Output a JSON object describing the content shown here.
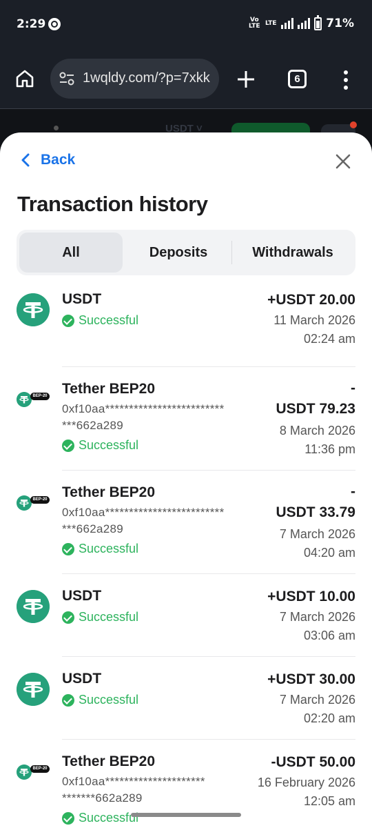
{
  "status_bar": {
    "time": "2:29",
    "volte": "Vo\nLTE",
    "lte": "LTE",
    "battery": "71%"
  },
  "browser": {
    "url": "1wqldy.com/?p=7xkk",
    "tab_count": "6"
  },
  "background": {
    "currency": "USDT ˅"
  },
  "header": {
    "back_label": "Back",
    "title": "Transaction history"
  },
  "tabs": [
    {
      "label": "All",
      "active": true
    },
    {
      "label": "Deposits",
      "active": false
    },
    {
      "label": "Withdrawals",
      "active": false
    }
  ],
  "transactions": [
    {
      "name": "USDT",
      "status": "Successful",
      "amount": "+USDT 20.00",
      "date": "11 March 2026",
      "time": "02:24 am"
    },
    {
      "name": "Tether BEP20",
      "address": "0xf10aa*************************\n***662a289",
      "badge": "BEP-20",
      "status": "Successful",
      "amount": "-\nUSDT 79.23",
      "date": "8 March 2026",
      "time": "11:36 pm"
    },
    {
      "name": "Tether BEP20",
      "address": "0xf10aa*************************\n***662a289",
      "badge": "BEP-20",
      "status": "Successful",
      "amount": "-\nUSDT 33.79",
      "date": "7 March 2026",
      "time": "04:20 am"
    },
    {
      "name": "USDT",
      "status": "Successful",
      "amount": "+USDT 10.00",
      "date": "7 March 2026",
      "time": "03:06 am"
    },
    {
      "name": "USDT",
      "status": "Successful",
      "amount": "+USDT 30.00",
      "date": "7 March 2026",
      "time": "02:20 am"
    },
    {
      "name": "Tether BEP20",
      "address": "0xf10aa*********************\n*******662a289",
      "badge": "BEP-20",
      "status": "Successful",
      "amount": "-USDT 50.00",
      "date": "16 February 2026",
      "time": "12:05 am"
    }
  ],
  "colors": {
    "accent": "#1a73e8",
    "success": "#2db35d",
    "tether": "#26a17b"
  }
}
